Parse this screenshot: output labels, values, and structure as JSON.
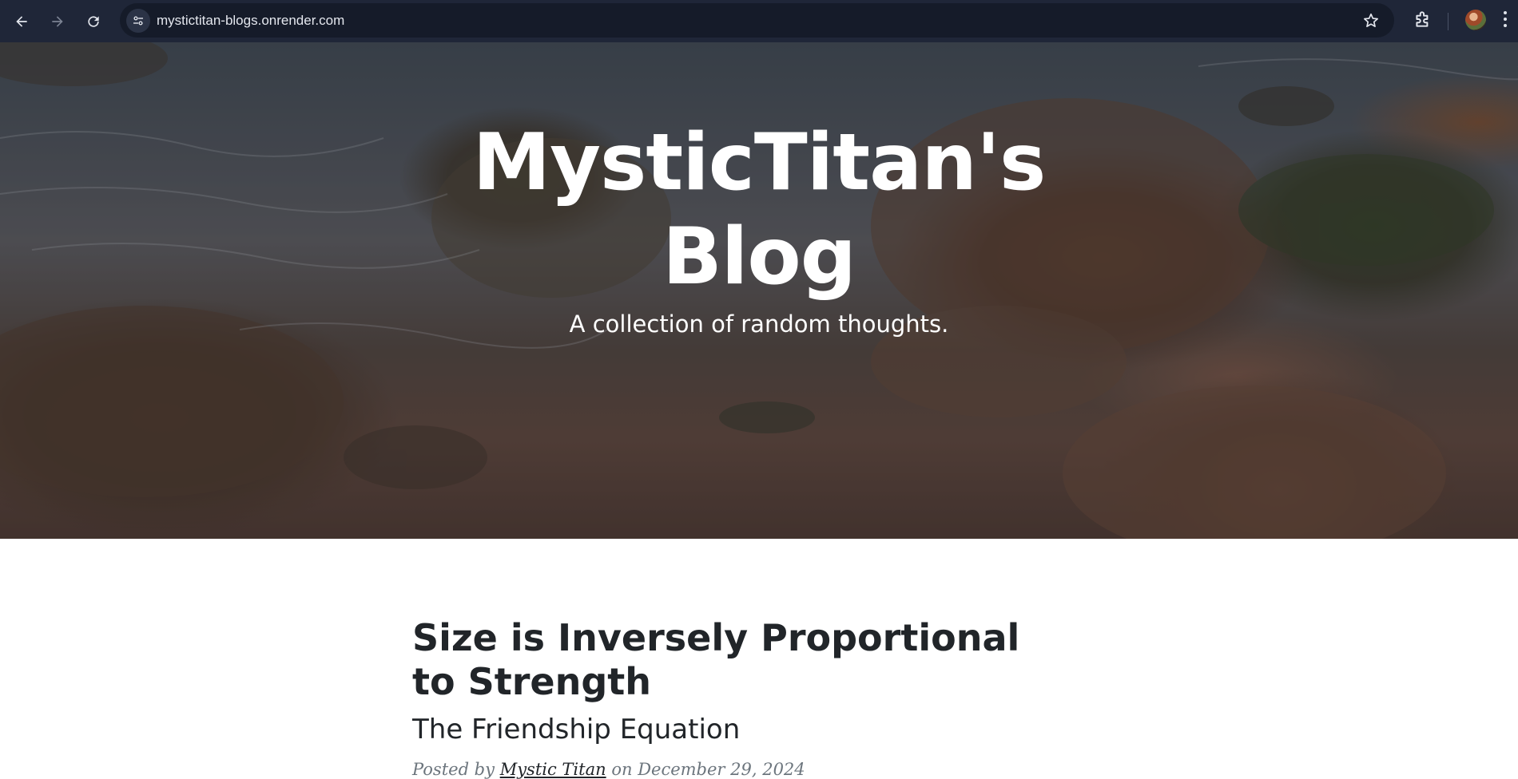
{
  "browser": {
    "url": "mystictitan-blogs.onrender.com",
    "icons": [
      "back-icon",
      "forward-icon",
      "reload-icon",
      "site-info-icon",
      "bookmark-star-icon",
      "extensions-icon",
      "profile-avatar",
      "more-menu-icon"
    ]
  },
  "hero": {
    "title": "MysticTitan's Blog",
    "subtitle": "A collection of random thoughts."
  },
  "posts": [
    {
      "title": "Size is Inversely Proportional to Strength",
      "subtitle": "The Friendship Equation",
      "meta_prefix": "Posted by",
      "author": "Mystic Titan",
      "meta_on": "on",
      "date": "December 29, 2024"
    }
  ]
}
